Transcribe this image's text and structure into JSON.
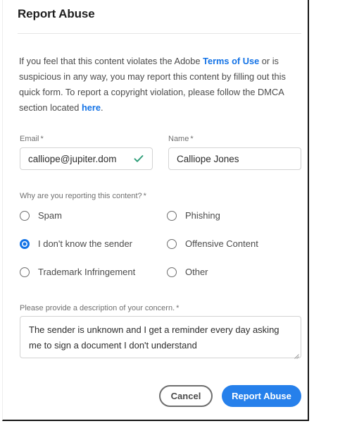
{
  "dialog": {
    "title": "Report Abuse",
    "intro": {
      "part1": "If you feel that this content violates the Adobe ",
      "link_terms": "Terms of Use",
      "part2": " or is suspicious in any way, you may report this content by filling out this quick form. To report a copyright violation, please follow the DMCA section located ",
      "link_here": "here",
      "part3": "."
    }
  },
  "fields": {
    "email": {
      "label": "Email",
      "required_mark": "*",
      "value": "calliope@jupiter.dom",
      "placeholder": "Email",
      "valid_icon": "check-icon"
    },
    "name": {
      "label": "Name",
      "required_mark": "*",
      "value": "Calliope Jones",
      "placeholder": "Name"
    }
  },
  "reason_group": {
    "label": "Why are you reporting this content?",
    "required_mark": "*",
    "options": [
      {
        "label": "Spam",
        "checked": false
      },
      {
        "label": "Phishing",
        "checked": false
      },
      {
        "label": "I don't know the sender",
        "checked": true
      },
      {
        "label": "Offensive Content",
        "checked": false
      },
      {
        "label": "Trademark Infringement",
        "checked": false
      },
      {
        "label": "Other",
        "checked": false
      }
    ]
  },
  "description": {
    "label": "Please provide a description of your concern.",
    "required_mark": "*",
    "value": "The sender is unknown and I get a reminder every day asking me to sign a document I don't understand",
    "placeholder": "",
    "resize_handle": "resize-grip-icon"
  },
  "footer": {
    "cancel_label": "Cancel",
    "submit_label": "Report Abuse"
  },
  "colors": {
    "accent_blue": "#2680eb",
    "link_blue": "#1473e6",
    "valid_green": "#2d9d78",
    "border_gray": "#d3d3d3",
    "label_gray": "#707070",
    "text_gray": "#4b4b4b"
  }
}
